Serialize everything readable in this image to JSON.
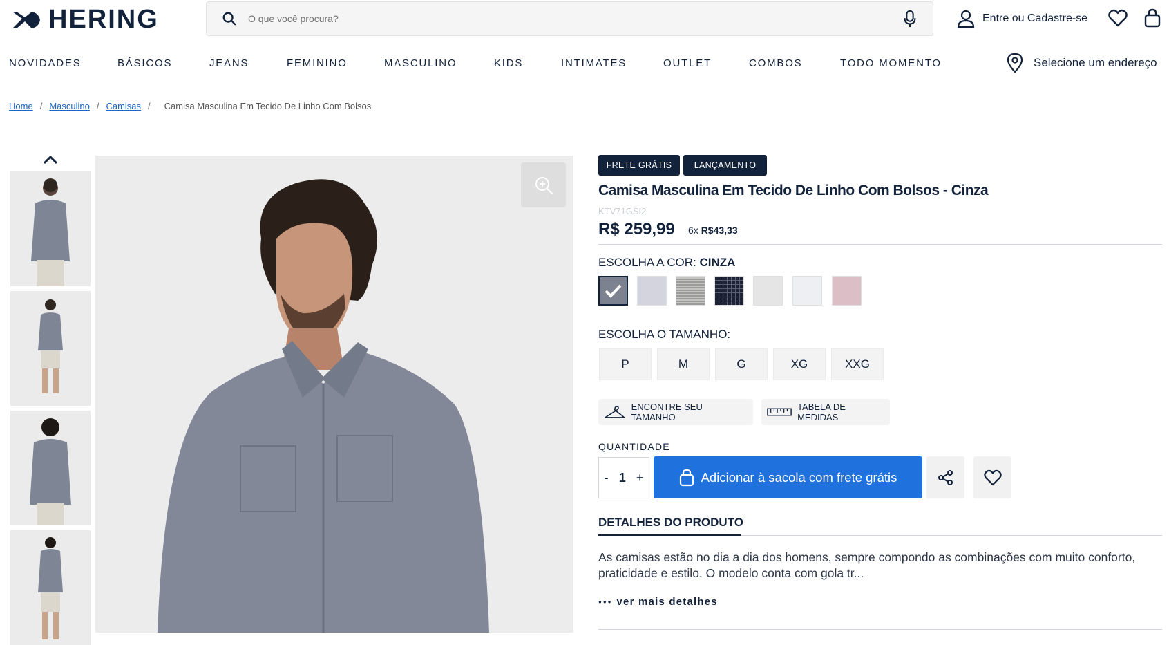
{
  "header": {
    "brand": "HERING",
    "search_placeholder": "O que você procura?",
    "account_label": "Entre ou Cadastre-se"
  },
  "nav": {
    "items": [
      "NOVIDADES",
      "BÁSICOS",
      "JEANS",
      "FEMININO",
      "MASCULINO",
      "KIDS",
      "INTIMATES",
      "OUTLET",
      "COMBOS",
      "TODO MOMENTO"
    ],
    "address_label": "Selecione um endereço"
  },
  "breadcrumb": {
    "items": [
      "Home",
      "Masculino",
      "Camisas"
    ],
    "separator": "/",
    "current": "Camisa Masculina Em Tecido De Linho Com Bolsos"
  },
  "product": {
    "badges": [
      "FRETE GRÁTIS",
      "LANÇAMENTO"
    ],
    "title": "Camisa Masculina Em Tecido De Linho Com Bolsos - Cinza",
    "sku": "KTV71GSI2",
    "price": "R$ 259,99",
    "installment_prefix": "6x",
    "installment_value": "R$43,33",
    "color_label": "ESCOLHA A COR:",
    "color_selected": "CINZA",
    "colors": [
      "#7d8290",
      "#d4d4de",
      "#a9aaa9",
      "#1c2234",
      "#e5e5e5",
      "#eeeff3",
      "#dcbfc6"
    ],
    "size_label": "ESCOLHA O TAMANHO:",
    "sizes": [
      "P",
      "M",
      "G",
      "XG",
      "XXG"
    ],
    "find_size_label": "ENCONTRE SEU TAMANHO",
    "size_table_label": "TABELA DE MEDIDAS",
    "quantity_label": "QUANTIDADE",
    "quantity_minus": "-",
    "quantity_value": "1",
    "quantity_plus": "+",
    "add_to_bag_label": "Adicionar à sacola com frete grátis",
    "details_tab": "DETALHES DO PRODUTO",
    "description": "As camisas estão no dia a dia dos homens, sempre compondo as combinações com muito conforto, praticidade e estilo. O modelo conta com gola tr...",
    "more_details_label": "ver mais detalhes"
  },
  "colors": {
    "brand_navy": "#13223b",
    "accent_blue": "#1f72de",
    "link_blue": "#1a66c5"
  }
}
